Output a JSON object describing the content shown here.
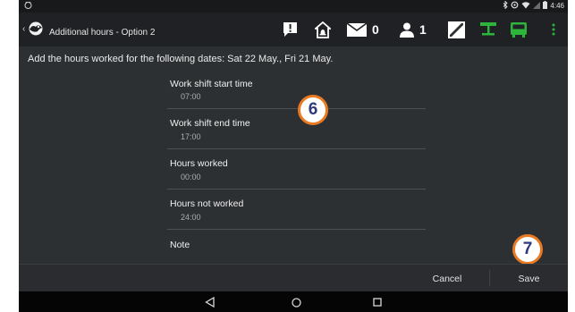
{
  "status_bar": {
    "left_icon": "android-debug-icon",
    "right_icons": [
      "bluetooth-icon",
      "data-sync-icon",
      "wifi-icon",
      "signal-icon",
      "battery-icon"
    ],
    "time": "4:46"
  },
  "action_bar": {
    "title": "Additional hours - Option 2",
    "icons": [
      "alert-icon",
      "home-alarm-icon",
      "mail-icon",
      "person-icon",
      "diagonal-box-icon",
      "network-icon",
      "bus-icon",
      "overflow-menu-icon"
    ],
    "mail_count": "0",
    "person_count": "1",
    "accent_colors": {
      "network": "#2db43a",
      "bus": "#2db43a"
    }
  },
  "main": {
    "instruction": "Add the hours worked for the following dates: Sat 22 May., Fri 21 May.",
    "fields": [
      {
        "label": "Work shift start time",
        "value": "07:00"
      },
      {
        "label": "Work shift end time",
        "value": "17:00"
      },
      {
        "label": "Hours worked",
        "value": "00:00"
      },
      {
        "label": "Hours not worked",
        "value": "24:00"
      },
      {
        "label": "Note",
        "value": ""
      }
    ]
  },
  "badges": {
    "fields_badge": "6",
    "save_badge": "7",
    "badge_border_color": "#ea7a22"
  },
  "buttons": {
    "cancel": "Cancel",
    "save": "Save"
  },
  "nav_bar": {
    "icons": [
      "back-icon",
      "home-icon",
      "recents-icon"
    ]
  }
}
